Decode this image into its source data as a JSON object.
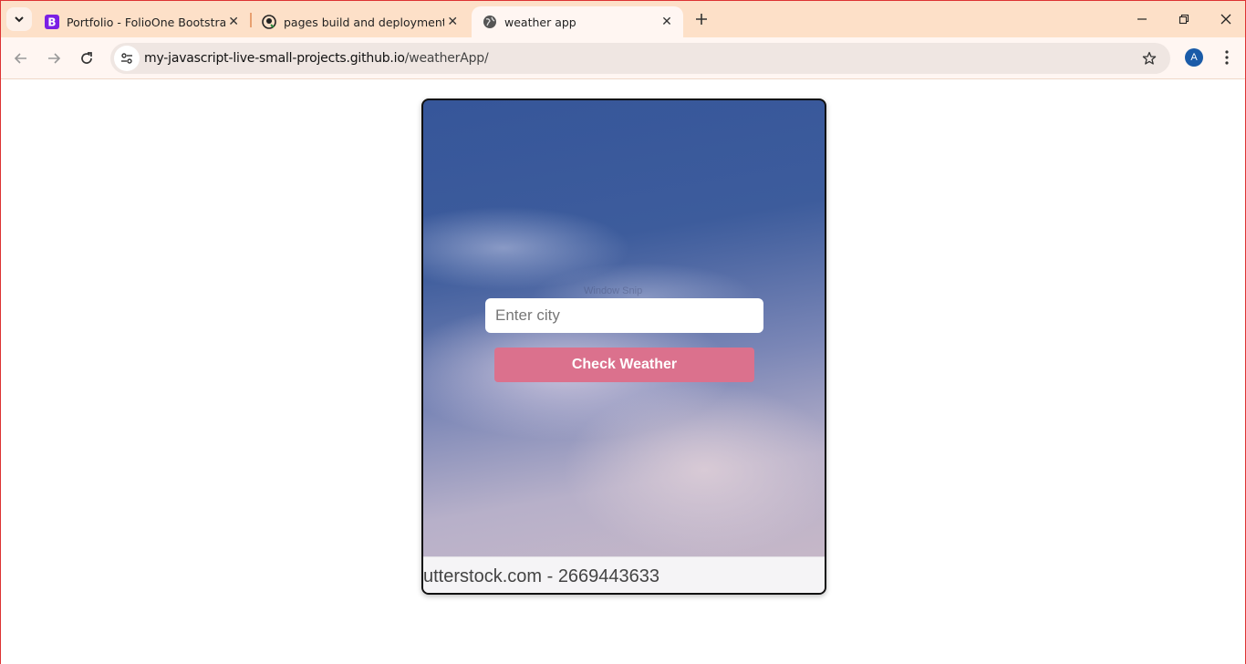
{
  "browser": {
    "tabs": [
      {
        "title": "Portfolio - FolioOne Bootstrap T",
        "favicon": "bootstrap-icon",
        "favicon_color": "#7b1fe4"
      },
      {
        "title": "pages build and deployment · M",
        "favicon": "github-icon"
      },
      {
        "title": "weather app",
        "favicon": "globe-icon",
        "active": true
      }
    ],
    "url_host": "my-javascript-live-small-projects.github.io",
    "url_path": "/weatherApp/",
    "profile_initial": "A"
  },
  "app": {
    "city_placeholder": "Enter city",
    "city_value": "",
    "button_label": "Check Weather",
    "button_color": "#db718d",
    "watermark_text": "Window Snip",
    "stock_caption": "utterstock.com - 2669443633"
  }
}
